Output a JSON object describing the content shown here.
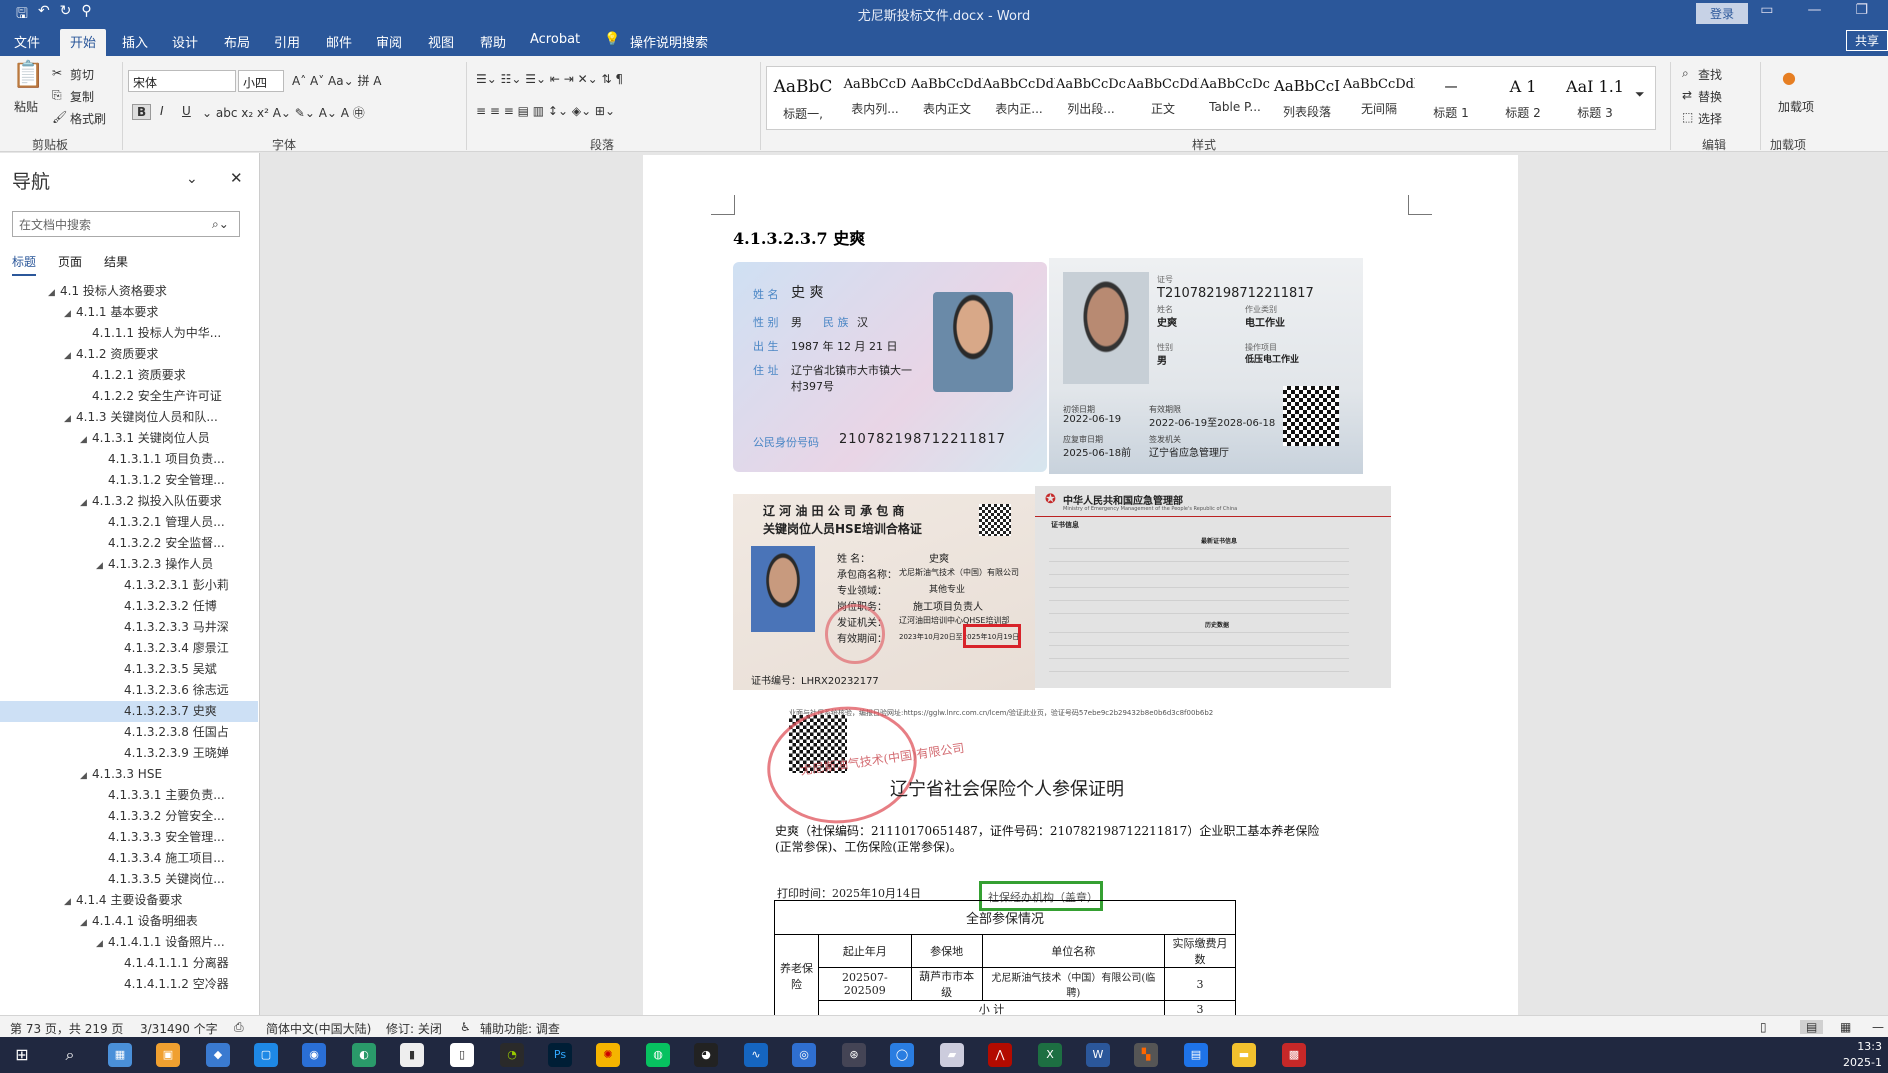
{
  "window": {
    "title": "尤尼斯投标文件.docx - Word",
    "login": "登录",
    "qat_icons": [
      "save-icon",
      "undo-icon",
      "redo-icon",
      "customize-icon"
    ]
  },
  "tabs": [
    "文件",
    "开始",
    "插入",
    "设计",
    "布局",
    "引用",
    "邮件",
    "审阅",
    "视图",
    "帮助",
    "Acrobat",
    "操作说明搜索"
  ],
  "active_tab": "开始",
  "share": "共享",
  "ribbon": {
    "clipboard": {
      "paste": "粘贴",
      "cut": "剪切",
      "copy": "复制",
      "format_painter": "格式刷",
      "label": "剪贴板"
    },
    "font": {
      "name": "宋体",
      "size": "小四",
      "label": "字体",
      "bold": "B",
      "italic": "I",
      "underline": "U"
    },
    "paragraph": {
      "label": "段落"
    },
    "styles": {
      "label": "样式",
      "items": [
        {
          "preview": "AaBbC",
          "name": "标题一,"
        },
        {
          "preview": "AaBbCcD",
          "name": "表内列..."
        },
        {
          "preview": "AaBbCcDdl",
          "name": "表内正文"
        },
        {
          "preview": "AaBbCcDdl",
          "name": "表内正..."
        },
        {
          "preview": "AaBbCcDc",
          "name": "列出段..."
        },
        {
          "preview": "AaBbCcDdl",
          "name": "正文"
        },
        {
          "preview": "AaBbCcDc",
          "name": "Table P..."
        },
        {
          "preview": "AaBbCcI",
          "name": "列表段落"
        },
        {
          "preview": "AaBbCcDdl",
          "name": "无间隔"
        },
        {
          "preview": "一",
          "name": "标题 1"
        },
        {
          "preview": "A 1",
          "name": "标题 2"
        },
        {
          "preview": "AaI 1.1",
          "name": "标题 3"
        }
      ]
    },
    "editing": {
      "find": "查找",
      "replace": "替换",
      "select": "选择",
      "label": "编辑"
    },
    "addins": {
      "load": "加载项",
      "label": "加载项"
    }
  },
  "nav": {
    "title": "导航",
    "search_placeholder": "在文档中搜索",
    "subtabs": [
      "标题",
      "页面",
      "结果"
    ],
    "items": [
      {
        "level": 1,
        "text": "4.1 投标人资格要求",
        "arrow": true
      },
      {
        "level": 2,
        "text": "4.1.1 基本要求",
        "arrow": true
      },
      {
        "level": 3,
        "text": "4.1.1.1 投标人为中华...",
        "arrow": false
      },
      {
        "level": 2,
        "text": "4.1.2 资质要求",
        "arrow": true
      },
      {
        "level": 3,
        "text": "4.1.2.1 资质要求",
        "arrow": false
      },
      {
        "level": 3,
        "text": "4.1.2.2 安全生产许可证",
        "arrow": false
      },
      {
        "level": 2,
        "text": "4.1.3 关键岗位人员和队...",
        "arrow": true
      },
      {
        "level": 3,
        "text": "4.1.3.1 关键岗位人员",
        "arrow": true
      },
      {
        "level": 4,
        "text": "4.1.3.1.1 项目负责...",
        "arrow": false
      },
      {
        "level": 4,
        "text": "4.1.3.1.2 安全管理...",
        "arrow": false
      },
      {
        "level": 3,
        "text": "4.1.3.2 拟投入队伍要求",
        "arrow": true
      },
      {
        "level": 4,
        "text": "4.1.3.2.1 管理人员...",
        "arrow": false
      },
      {
        "level": 4,
        "text": "4.1.3.2.2 安全监督...",
        "arrow": false
      },
      {
        "level": 4,
        "text": "4.1.3.2.3 操作人员",
        "arrow": true
      },
      {
        "level": 5,
        "text": "4.1.3.2.3.1 彭小莉",
        "arrow": false
      },
      {
        "level": 5,
        "text": "4.1.3.2.3.2 任博",
        "arrow": false
      },
      {
        "level": 5,
        "text": "4.1.3.2.3.3 马井深",
        "arrow": false
      },
      {
        "level": 5,
        "text": "4.1.3.2.3.4 廖景江",
        "arrow": false
      },
      {
        "level": 5,
        "text": "4.1.3.2.3.5 吴斌",
        "arrow": false
      },
      {
        "level": 5,
        "text": "4.1.3.2.3.6 徐志远",
        "arrow": false
      },
      {
        "level": 5,
        "text": "4.1.3.2.3.7 史爽",
        "arrow": false,
        "selected": true
      },
      {
        "level": 5,
        "text": "4.1.3.2.3.8 任国占",
        "arrow": false
      },
      {
        "level": 5,
        "text": "4.1.3.2.3.9 王晓婵",
        "arrow": false
      },
      {
        "level": 3,
        "text": "4.1.3.3 HSE",
        "arrow": true
      },
      {
        "level": 4,
        "text": "4.1.3.3.1 主要负责...",
        "arrow": false
      },
      {
        "level": 4,
        "text": "4.1.3.3.2 分管安全...",
        "arrow": false
      },
      {
        "level": 4,
        "text": "4.1.3.3.3 安全管理...",
        "arrow": false
      },
      {
        "level": 4,
        "text": "4.1.3.3.4 施工项目...",
        "arrow": false
      },
      {
        "level": 4,
        "text": "4.1.3.3.5 关键岗位...",
        "arrow": false
      },
      {
        "level": 2,
        "text": "4.1.4 主要设备要求",
        "arrow": true
      },
      {
        "level": 3,
        "text": "4.1.4.1 设备明细表",
        "arrow": true
      },
      {
        "level": 4,
        "text": "4.1.4.1.1 设备照片...",
        "arrow": true
      },
      {
        "level": 5,
        "text": "4.1.4.1.1.1 分离器",
        "arrow": false
      },
      {
        "level": 5,
        "text": "4.1.4.1.1.2 空冷器",
        "arrow": false
      }
    ]
  },
  "doc": {
    "heading": "4.1.3.2.3.7    史爽",
    "id_card": {
      "name_label": "姓 名",
      "name": "史 爽",
      "sex_label": "性 别",
      "sex": "男",
      "ethnic_label": "民 族",
      "ethnic": "汉",
      "birth_label": "出 生",
      "birth": "1987 年 12 月 21 日",
      "addr_label": "住 址",
      "addr1": "辽宁省北镇市大市镇大一",
      "addr2": "村397号",
      "id_label": "公民身份号码",
      "id": "210782198712211817"
    },
    "op_cert": {
      "no_label": "证号",
      "no": "T210782198712211817",
      "name_label": "姓名",
      "name": "史爽",
      "type_label": "作业类别",
      "type": "电工作业",
      "sex_label": "性别",
      "sex": "男",
      "item_label": "操作项目",
      "item": "低压电工作业",
      "first_label": "初领日期",
      "first": "2022-06-19",
      "valid_label": "有效期限",
      "valid": "2022-06-19至2028-06-18",
      "review_label": "应复审日期",
      "review": "2025-06-18前",
      "org_label": "签发机关",
      "org": "辽宁省应急管理厅"
    },
    "hse_cert": {
      "title1": "辽 河 油 田 公 司 承 包 商",
      "title2": "关键岗位人员HSE培训合格证",
      "name_label": "姓     名：",
      "name": "史爽",
      "company_label": "承包商名称：",
      "company": "尤尼斯油气技术（中国）有限公司",
      "field_label": "专业领域：",
      "field": "其他专业",
      "post_label": "岗位职务：",
      "post": "施工项目负责人",
      "issuer_label": "发证机关：",
      "issuer": "辽河油田培训中心QHSE培训部",
      "period_label": "有效期间：",
      "period": "2023年10月20日至2025年10月19日",
      "no": "证书编号：LHRX20232177"
    },
    "ministry": {
      "title": "中华人民共和国应急管理部",
      "subtitle": "Ministry of Emergency Management of the People's Republic of China",
      "section": "证书信息",
      "latest": "最新证书信息",
      "history": "历史数据"
    },
    "verify_line": "业面与社保系统核验，编报日验网址:https://gglw.lnrc.com.cn/lcem/验证此业页，验证号码57ebe9c2b29432b8e0b6d3c8f00b6b2",
    "cert_title": "辽宁省社会保险个人参保证明",
    "cert_text": "史爽（社保编码：21110170651487，证件号码：210782198712211817）企业职工基本养老保险(正常参保)、工伤保险(正常参保)。",
    "print_time": "打印时间：2025年10月14日",
    "agency": "社保经办机构（盖章）",
    "stamp_text": "尤尼斯油气技术(中国)有限公司",
    "table": {
      "caption": "全部参保情况",
      "headers": [
        "起止年月",
        "参保地",
        "单位名称",
        "实际缴费月数"
      ],
      "category": "养老保险",
      "row": [
        "202507-202509",
        "葫芦市市本级",
        "尤尼斯油气技术（中国）有限公司(临聘)",
        "3"
      ],
      "subtotal_label": "小     计",
      "subtotal": "3"
    }
  },
  "status": {
    "page": "第 73 页，共 219 页",
    "words": "3/31490 个字",
    "lang": "简体中文(中国大陆)",
    "track": "修订: 关闭",
    "access": "辅助功能: 调查"
  },
  "clock": {
    "time": "13:3",
    "date": "2025-1"
  },
  "colors": {
    "word_blue": "#2b579a",
    "red_box": "#d8232a",
    "green_box": "#35a032"
  }
}
